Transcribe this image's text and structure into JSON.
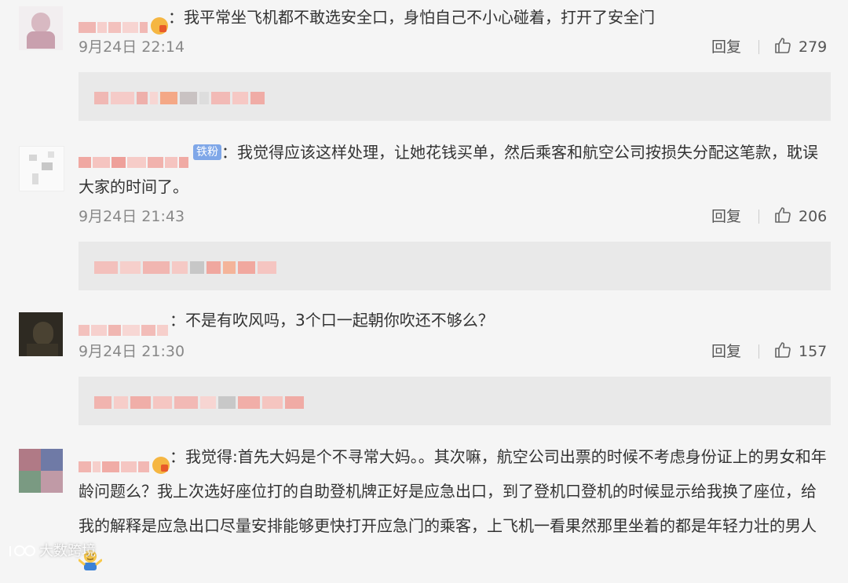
{
  "comments": [
    {
      "text": "：我平常坐飞机都不敢选安全口，身怕自己不小心碰着，打开了安全门",
      "date": "9月24日 22:14",
      "reply_label": "回复",
      "likes": "279"
    },
    {
      "badge": "铁粉",
      "text": "：我觉得应该这样处理，让她花钱买单，然后乘客和航空公司按损失分配这笔款，耽误大家的时间了。",
      "date": "9月24日 21:43",
      "reply_label": "回复",
      "likes": "206"
    },
    {
      "text": "：不是有吹风吗，3个口一起朝你吹还不够么？",
      "date": "9月24日 21:30",
      "reply_label": "回复",
      "likes": "157"
    },
    {
      "text": "：我觉得:首先大妈是个不寻常大妈。。其次嘛，航空公司出票的时候不考虑身份证上的男女和年龄问题么？我上次选好座位打的自助登机牌正好是应急出口，到了登机口登机的时候显示给我换了座位，给我的解释是应急出口尽量安排能够更快打开应急门的乘客，上飞机一看果然那里坐着的都是年轻力壮的男人"
    }
  ],
  "watermark": "大数跨境",
  "colors": {
    "background": "#f5f5f5",
    "reply_box": "#e9e9e9",
    "meta": "#888888",
    "badge": "#7fa7e8"
  },
  "icons": {
    "like": "thumbs-up-icon",
    "watermark": "logo-icon",
    "emoji": "shrug-emoji-icon"
  }
}
